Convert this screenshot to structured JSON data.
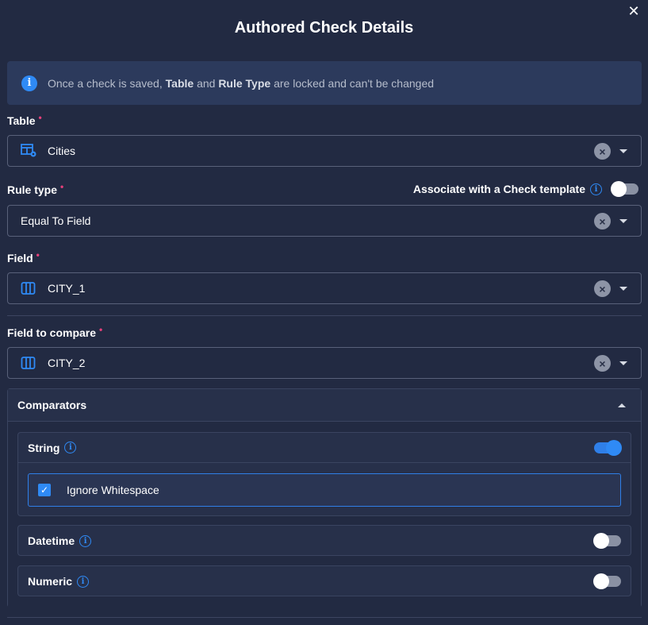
{
  "dialog": {
    "title": "Authored Check Details",
    "close_glyph": "✕"
  },
  "banner": {
    "icon": "info-icon",
    "text_prefix": "Once a check is saved,",
    "bold_1": "Table",
    "text_mid": "and",
    "bold_2": "Rule Type",
    "text_suffix": "are locked and can't be changed"
  },
  "table": {
    "label": "Table",
    "required": "•",
    "value": "Cities",
    "icon": "table-settings-icon"
  },
  "rule_type": {
    "label": "Rule type",
    "required": "•",
    "value": "Equal To Field"
  },
  "associate": {
    "label": "Associate with a Check template",
    "enabled": false
  },
  "field": {
    "label": "Field",
    "required": "•",
    "value": "CITY_1",
    "icon": "columns-icon"
  },
  "field_compare": {
    "label": "Field to compare",
    "required": "•",
    "value": "CITY_2",
    "icon": "columns-icon"
  },
  "comparators": {
    "title": "Comparators",
    "string": {
      "label": "String",
      "enabled": true,
      "option_label": "Ignore Whitespace",
      "option_checked": true
    },
    "datetime": {
      "label": "Datetime",
      "enabled": false
    },
    "numeric": {
      "label": "Numeric",
      "enabled": false
    }
  },
  "colors": {
    "background": "#222a42",
    "accent": "#2f8af5",
    "required": "#e6407a"
  }
}
